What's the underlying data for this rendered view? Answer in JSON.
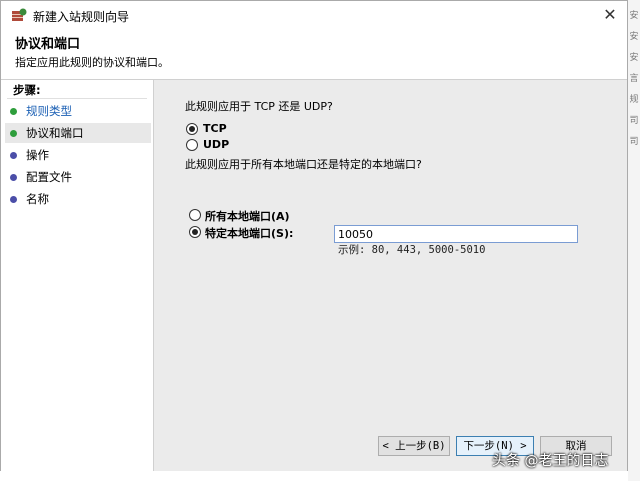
{
  "window": {
    "title": "新建入站规则向导",
    "close_glyph": "✕"
  },
  "header": {
    "title": "协议和端口",
    "subtitle": "指定应用此规则的协议和端口。"
  },
  "sidebar": {
    "label": "步骤:",
    "items": [
      {
        "label": "规则类型",
        "color": "#2e9e3c"
      },
      {
        "label": "协议和端口",
        "color": "#2e9e3c"
      },
      {
        "label": "操作",
        "color": "#4b4ea8"
      },
      {
        "label": "配置文件",
        "color": "#4b4ea8"
      },
      {
        "label": "名称",
        "color": "#4b4ea8"
      }
    ]
  },
  "protocol": {
    "question": "此规则应用于 TCP 还是 UDP?",
    "options": [
      "TCP",
      "UDP"
    ],
    "selected": "TCP"
  },
  "ports": {
    "question": "此规则应用于所有本地端口还是特定的本地端口?",
    "options": [
      "所有本地端口(A)",
      "特定本地端口(S):"
    ],
    "selected": "特定本地端口(S):",
    "value": "10050",
    "example": "示例: 80, 443, 5000-5010"
  },
  "buttons": {
    "back": "< 上一步(B)",
    "next": "下一步(N) >",
    "cancel": "取消"
  },
  "right_strip": [
    "安",
    "安",
    "安",
    "言",
    "规",
    "司",
    "司"
  ],
  "watermark": "头条 @老王的日志"
}
